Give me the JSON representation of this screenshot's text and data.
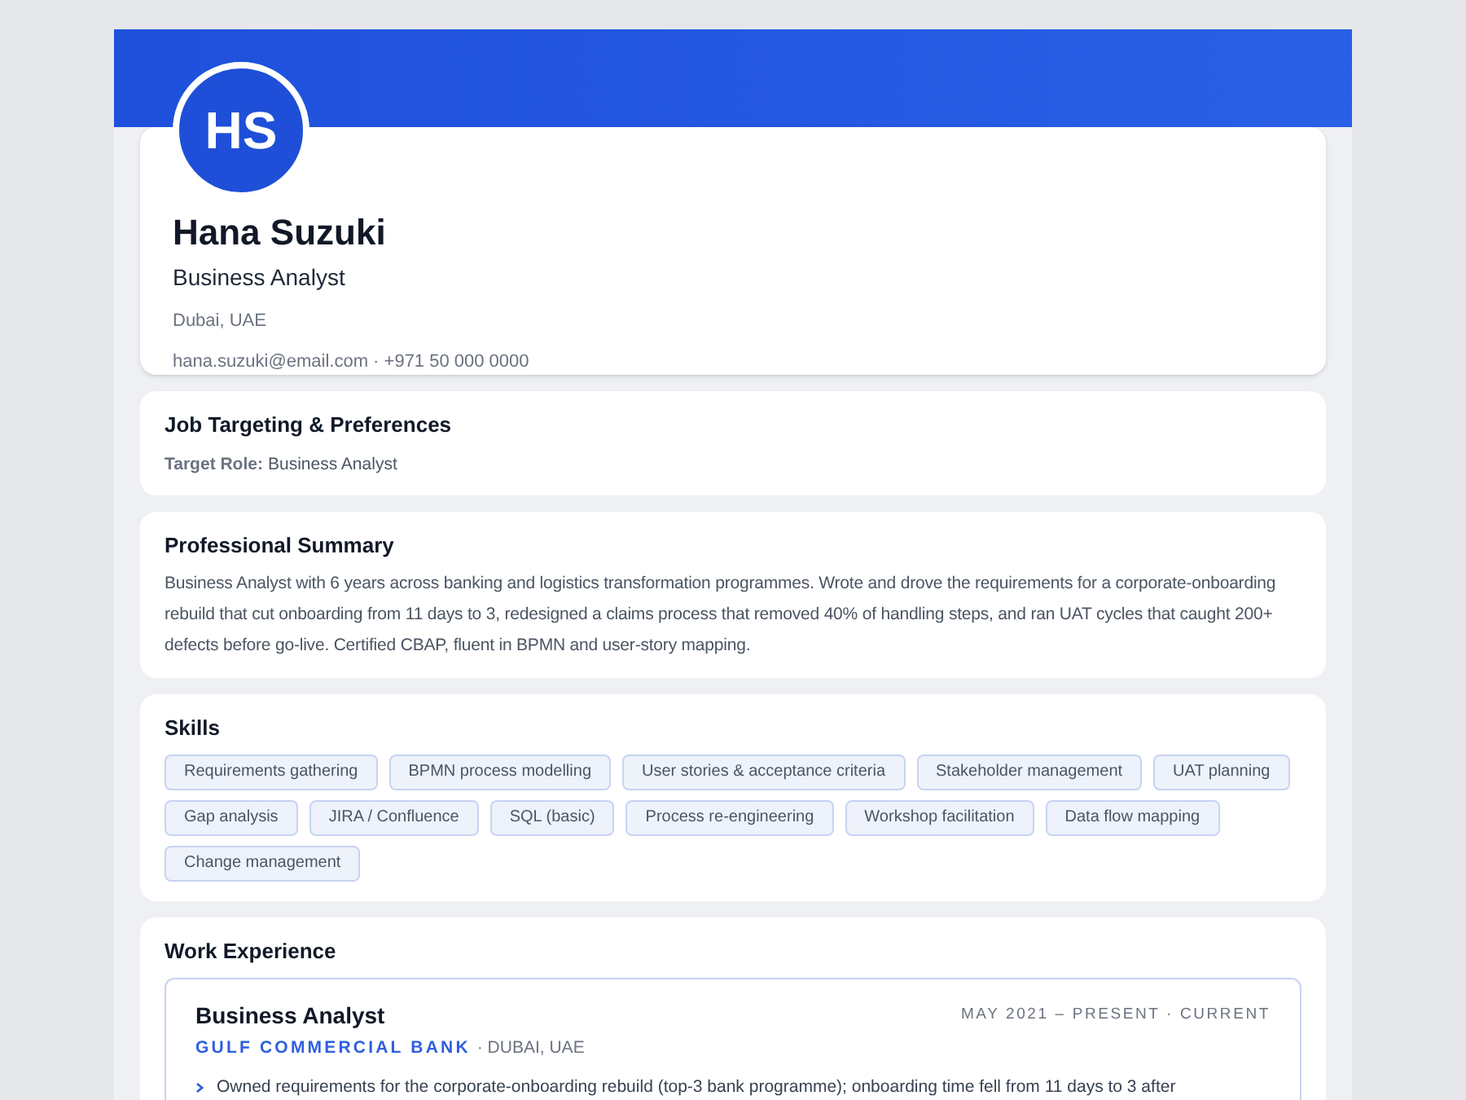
{
  "profile": {
    "initials": "HS",
    "name": "Hana Suzuki",
    "headline": "Business Analyst",
    "location": "Dubai, UAE",
    "contact": "hana.suzuki@email.com · +971 50 000 0000"
  },
  "job_targeting": {
    "title": "Job Targeting & Preferences",
    "label": "Target Role:",
    "value": "Business Analyst"
  },
  "summary": {
    "title": "Professional Summary",
    "text": "Business Analyst with 6 years across banking and logistics transformation programmes. Wrote and drove the requirements for a corporate-onboarding rebuild that cut onboarding from 11 days to 3, redesigned a claims process that removed 40% of handling steps, and ran UAT cycles that caught 200+ defects before go-live. Certified CBAP, fluent in BPMN and user-story mapping."
  },
  "skills": {
    "title": "Skills",
    "items": [
      "Requirements gathering",
      "BPMN process modelling",
      "User stories & acceptance criteria",
      "Stakeholder management",
      "UAT planning",
      "Gap analysis",
      "JIRA / Confluence",
      "SQL (basic)",
      "Process re-engineering",
      "Workshop facilitation",
      "Data flow mapping",
      "Change management"
    ]
  },
  "experience": {
    "title": "Work Experience",
    "jobs": [
      {
        "role": "Business Analyst",
        "dates": "MAY 2021 – PRESENT · CURRENT",
        "company": "GULF COMMERCIAL BANK",
        "place": "· DUBAI, UAE",
        "bullets": [
          "Owned requirements for the corporate-onboarding rebuild (top-3 bank programme); onboarding time fell from 11 days to 3 after"
        ]
      }
    ]
  }
}
